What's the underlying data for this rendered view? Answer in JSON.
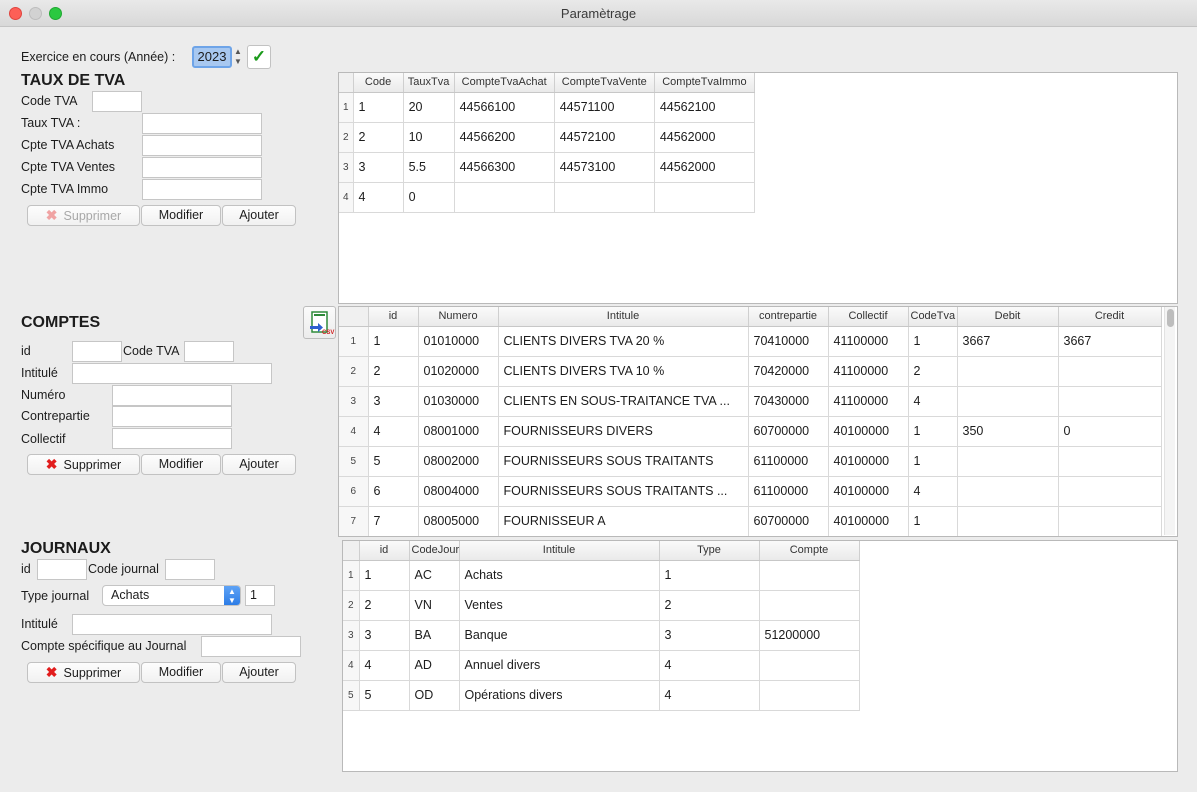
{
  "window": {
    "title": "Paramètrage"
  },
  "exercice": {
    "label": "Exercice en cours  (Année) :",
    "year": "2023"
  },
  "tva": {
    "heading": "TAUX DE TVA",
    "labels": {
      "code": "Code TVA",
      "taux": "Taux TVA :",
      "achats": "Cpte TVA Achats",
      "ventes": "Cpte TVA Ventes",
      "immo": "Cpte TVA Immo"
    },
    "buttons": {
      "supprimer": "Supprimer",
      "modifier": "Modifier",
      "ajouter": "Ajouter"
    },
    "table": {
      "headers": [
        "Code",
        "TauxTva",
        "CompteTvaAchat",
        "CompteTvaVente",
        "CompteTvaImmo"
      ],
      "rows": [
        {
          "n": "1",
          "cells": [
            "1",
            "20",
            "44566100",
            "44571100",
            "44562100"
          ]
        },
        {
          "n": "2",
          "cells": [
            "2",
            "10",
            "44566200",
            "44572100",
            "44562000"
          ]
        },
        {
          "n": "3",
          "cells": [
            "3",
            "5.5",
            "44566300",
            "44573100",
            "44562000"
          ]
        },
        {
          "n": "4",
          "cells": [
            "4",
            "0",
            "",
            "",
            ""
          ]
        }
      ]
    }
  },
  "comptes": {
    "heading": "COMPTES",
    "labels": {
      "id": "id",
      "codetva": "Code TVA",
      "intitule": "Intitulé",
      "numero": "Numéro",
      "contrepartie": "Contrepartie",
      "collectif": "Collectif"
    },
    "buttons": {
      "supprimer": "Supprimer",
      "modifier": "Modifier",
      "ajouter": "Ajouter"
    },
    "csv_label": "CSV",
    "table": {
      "headers": [
        "id",
        "Numero",
        "Intitule",
        "contrepartie",
        "Collectif",
        "CodeTva",
        "Debit",
        "Credit"
      ],
      "rows": [
        {
          "n": "1",
          "cells": [
            "1",
            "01010000",
            "CLIENTS DIVERS TVA 20 %",
            "70410000",
            "41100000",
            "1",
            "3667",
            "3667"
          ]
        },
        {
          "n": "2",
          "cells": [
            "2",
            "01020000",
            "CLIENTS DIVERS TVA 10 %",
            "70420000",
            "41100000",
            "2",
            "",
            ""
          ]
        },
        {
          "n": "3",
          "cells": [
            "3",
            "01030000",
            "CLIENTS EN SOUS-TRAITANCE TVA ...",
            "70430000",
            "41100000",
            "4",
            "",
            ""
          ]
        },
        {
          "n": "4",
          "cells": [
            "4",
            "08001000",
            "FOURNISSEURS DIVERS",
            "60700000",
            "40100000",
            "1",
            "350",
            "0"
          ]
        },
        {
          "n": "5",
          "cells": [
            "5",
            "08002000",
            "FOURNISSEURS SOUS TRAITANTS",
            "61100000",
            "40100000",
            "1",
            "",
            ""
          ]
        },
        {
          "n": "6",
          "cells": [
            "6",
            "08004000",
            "FOURNISSEURS SOUS TRAITANTS ...",
            "61100000",
            "40100000",
            "4",
            "",
            ""
          ]
        },
        {
          "n": "7",
          "cells": [
            "7",
            "08005000",
            "FOURNISSEUR A",
            "60700000",
            "40100000",
            "1",
            "",
            ""
          ]
        }
      ]
    }
  },
  "journaux": {
    "heading": "JOURNAUX",
    "labels": {
      "id": "id",
      "code": "Code journal",
      "type": "Type journal",
      "intitule": "Intitulé",
      "compte": "Compte spécifique au Journal"
    },
    "type_selected": "Achats",
    "type_value": "1",
    "buttons": {
      "supprimer": "Supprimer",
      "modifier": "Modifier",
      "ajouter": "Ajouter"
    },
    "table": {
      "headers": [
        "id",
        "CodeJournal",
        "Intitule",
        "Type",
        "Compte"
      ],
      "rows": [
        {
          "n": "1",
          "cells": [
            "1",
            "AC",
            "Achats",
            "1",
            ""
          ]
        },
        {
          "n": "2",
          "cells": [
            "2",
            "VN",
            "Ventes",
            "2",
            ""
          ]
        },
        {
          "n": "3",
          "cells": [
            "3",
            "BA",
            "Banque",
            "3",
            "51200000"
          ]
        },
        {
          "n": "4",
          "cells": [
            "4",
            "AD",
            "Annuel divers",
            "4",
            ""
          ]
        },
        {
          "n": "5",
          "cells": [
            "5",
            "OD",
            "Opérations divers",
            "4",
            ""
          ]
        }
      ]
    }
  }
}
